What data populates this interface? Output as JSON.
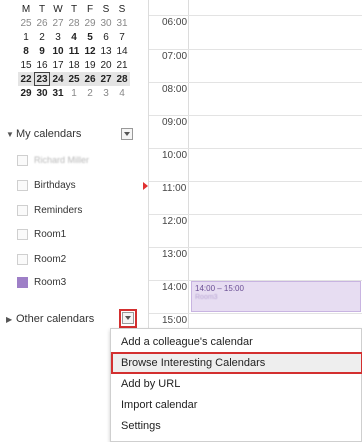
{
  "mini_calendar": {
    "weekdays": [
      "M",
      "T",
      "W",
      "T",
      "F",
      "S",
      "S"
    ],
    "weeks": [
      [
        "25",
        "26",
        "27",
        "28",
        "29",
        "30",
        "31"
      ],
      [
        "1",
        "2",
        "3",
        "4",
        "5",
        "6",
        "7"
      ],
      [
        "8",
        "9",
        "10",
        "11",
        "12",
        "13",
        "14"
      ],
      [
        "15",
        "16",
        "17",
        "18",
        "19",
        "20",
        "21"
      ],
      [
        "22",
        "23",
        "24",
        "25",
        "26",
        "27",
        "28"
      ],
      [
        "29",
        "30",
        "31",
        "1",
        "2",
        "3",
        "4"
      ]
    ],
    "selected_day": "23"
  },
  "my_calendars": {
    "title": "My calendars",
    "items": [
      {
        "label": "Richard Miller",
        "color": "#fafafa",
        "blurred": true
      },
      {
        "label": "Birthdays",
        "color": "#fafafa"
      },
      {
        "label": "Reminders",
        "color": "#fafafa"
      },
      {
        "label": "Room1",
        "color": "#fafafa"
      },
      {
        "label": "Room2",
        "color": "#fafafa"
      },
      {
        "label": "Room3",
        "color": "#9e7fc7"
      }
    ]
  },
  "other_calendars": {
    "title": "Other calendars"
  },
  "time_grid": {
    "hours": [
      "06:00",
      "07:00",
      "08:00",
      "09:00",
      "10:00",
      "11:00",
      "12:00",
      "13:00",
      "14:00",
      "15:00"
    ]
  },
  "event": {
    "time": "14:00 – 15:00",
    "title": "Room3",
    "color": "#e7ddf2"
  },
  "menu": {
    "items": [
      {
        "label": "Add a colleague's calendar"
      },
      {
        "label": "Browse Interesting Calendars",
        "active": true
      },
      {
        "label": "Add by URL"
      },
      {
        "label": "Import calendar"
      },
      {
        "label": "Settings"
      }
    ]
  },
  "colors": {
    "accent_red": "#d32f2f",
    "room3_purple": "#9e7fc7"
  }
}
